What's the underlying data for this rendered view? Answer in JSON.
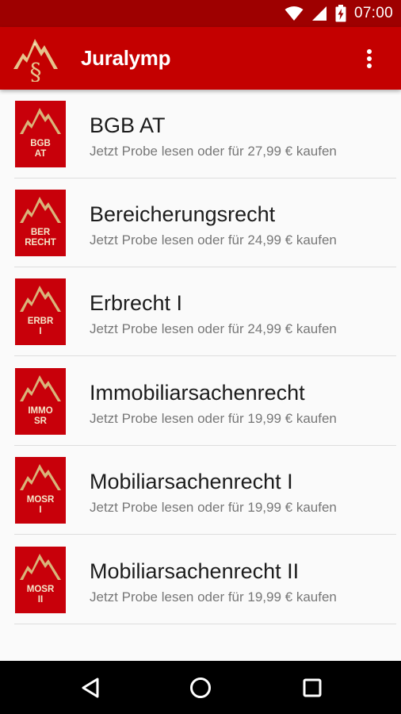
{
  "status_bar": {
    "time": "07:00",
    "icons": [
      "wifi-icon",
      "signal-icon",
      "battery-charging-icon"
    ]
  },
  "app_bar": {
    "title": "Juralymp",
    "logo": "juralymp-logo-icon",
    "menu_icon": "overflow-menu-icon"
  },
  "books": [
    {
      "title": "BGB AT",
      "subtitle": "Jetzt Probe lesen oder für 27,99 € kaufen",
      "code_line1": "BGB",
      "code_line2": "AT"
    },
    {
      "title": "Bereicherungsrecht",
      "subtitle": "Jetzt Probe lesen oder für 24,99 € kaufen",
      "code_line1": "BER",
      "code_line2": "RECHT"
    },
    {
      "title": "Erbrecht I",
      "subtitle": "Jetzt Probe lesen oder für 24,99 € kaufen",
      "code_line1": "ERBR",
      "code_line2": "I"
    },
    {
      "title": "Immobiliarsachenrecht",
      "subtitle": "Jetzt Probe lesen oder für 19,99 € kaufen",
      "code_line1": "IMMO",
      "code_line2": "SR"
    },
    {
      "title": "Mobiliarsachenrecht I",
      "subtitle": "Jetzt Probe lesen oder für 19,99 € kaufen",
      "code_line1": "MOSR",
      "code_line2": "I"
    },
    {
      "title": "Mobiliarsachenrecht II",
      "subtitle": "Jetzt Probe lesen oder für 19,99 € kaufen",
      "code_line1": "MOSR",
      "code_line2": "II"
    }
  ],
  "nav_bar": {
    "icons": [
      "back-icon",
      "home-icon",
      "recents-icon"
    ]
  },
  "colors": {
    "status_bar": "#9e0000",
    "app_bar": "#c40000",
    "book_red": "#c8000a",
    "gold": "#d9b47a"
  }
}
